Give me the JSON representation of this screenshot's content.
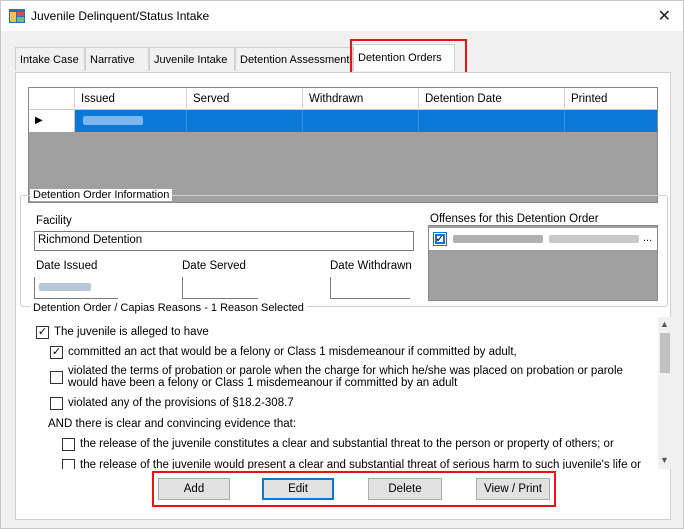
{
  "window": {
    "title": "Juvenile Delinquent/Status Intake",
    "close_label": "✕"
  },
  "tabs": [
    {
      "label": "Intake Case"
    },
    {
      "label": "Narrative"
    },
    {
      "label": "Juvenile Intake"
    },
    {
      "label": "Detention Assessment"
    },
    {
      "label": "Detention Orders"
    }
  ],
  "active_tab": "Detention Orders",
  "grid": {
    "columns": [
      "Issued",
      "Served",
      "Withdrawn",
      "Detention Date",
      "Printed"
    ],
    "row_marker": "▶"
  },
  "detention_info": {
    "legend": "Detention Order Information",
    "facility_label": "Facility",
    "facility_value": "Richmond Detention",
    "date_issued_label": "Date Issued",
    "date_served_label": "Date Served",
    "date_withdrawn_label": "Date Withdrawn",
    "offenses_label": "Offenses for this Detention Order",
    "offense_ellipsis": "..."
  },
  "reasons": {
    "legend": "Detention Order / Capias Reasons - 1 Reason Selected",
    "items": [
      {
        "text": "The juvenile is alleged to have",
        "checked": true
      },
      {
        "text": "committed an act that would be a felony or Class 1 misdemeanour if committed by adult,",
        "checked": true
      },
      {
        "text": "violated the terms of probation or parole when the charge for which he/she was placed on probation or parole would have been a felony or Class 1 misdemeanour if committed by an adult",
        "checked": false
      },
      {
        "text": "violated any of the provisions of §18.2-308.7",
        "checked": false
      },
      {
        "text": "AND there is clear and convincing evidence that:"
      },
      {
        "text": "the release of the juvenile constitutes a clear and substantial threat to the person or property of others; or",
        "checked": false
      },
      {
        "text": "the release of the juvenile would present a clear and substantial threat of serious harm to such juvenile's life or",
        "checked": false
      }
    ],
    "check_glyph": "✓"
  },
  "buttons": {
    "add": "Add",
    "edit": "Edit",
    "delete": "Delete",
    "view_print": "View / Print"
  },
  "colors": {
    "selection_blue": "#0a78d7",
    "highlight_red": "#e11111"
  }
}
